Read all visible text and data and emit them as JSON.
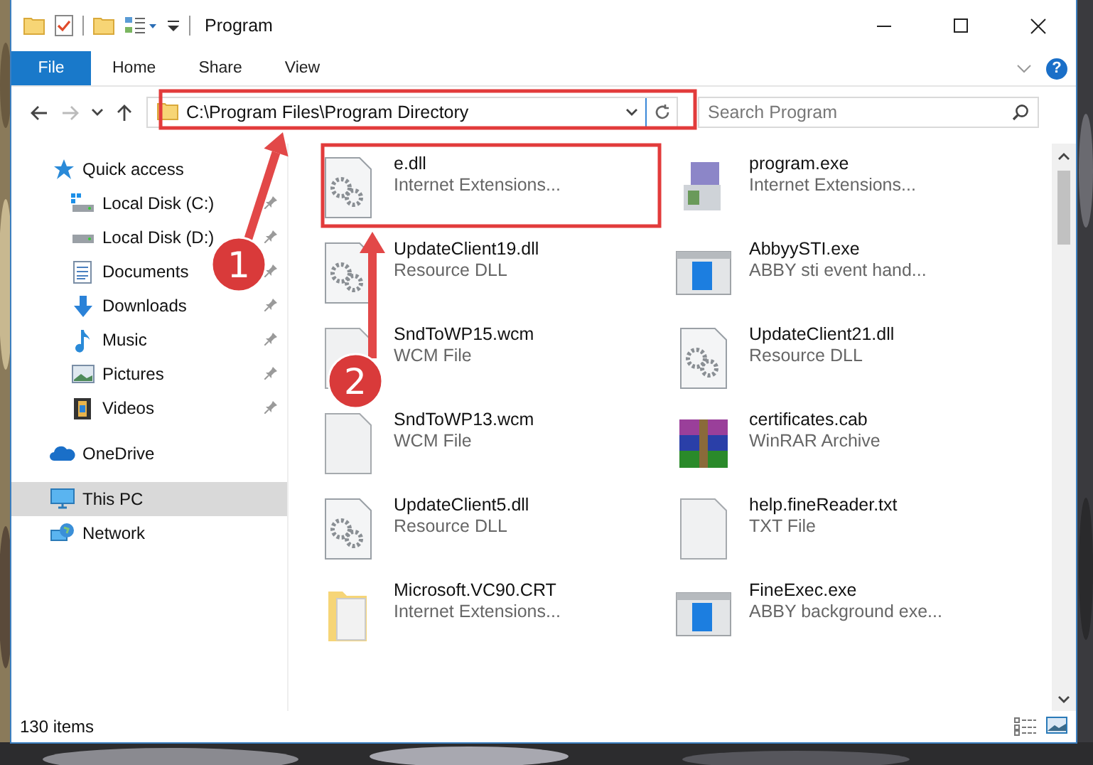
{
  "window": {
    "title": "Program"
  },
  "quick_access_toolbar": [
    {
      "kind": "folder"
    },
    {
      "kind": "properties"
    },
    {
      "kind": "new-folder"
    },
    {
      "kind": "view-dropdown"
    },
    {
      "kind": "customize"
    }
  ],
  "ribbon": {
    "file_tab": "File",
    "tabs": [
      {
        "label": "Home",
        "selected": false
      },
      {
        "label": "Share",
        "selected": false
      },
      {
        "label": "View",
        "selected": false
      }
    ],
    "help": "?"
  },
  "address_bar": {
    "path": "C:\\Program Files\\Program Directory"
  },
  "search": {
    "placeholder": "Search Program"
  },
  "navigation": [
    {
      "label": "Quick access",
      "kind": "star",
      "selected": false,
      "children": [
        {
          "label": "Local Disk (C:)",
          "kind": "drive-c",
          "pinned": true,
          "selected": false
        },
        {
          "label": "Local Disk (D:)",
          "kind": "drive",
          "pinned": true,
          "selected": false
        },
        {
          "label": "Documents",
          "kind": "documents",
          "pinned": true,
          "selected": false
        },
        {
          "label": "Downloads",
          "kind": "downloads",
          "pinned": true,
          "selected": false
        },
        {
          "label": "Music",
          "kind": "music",
          "pinned": true,
          "selected": false
        },
        {
          "label": "Pictures",
          "kind": "pictures",
          "pinned": true,
          "selected": false
        },
        {
          "label": "Videos",
          "kind": "videos",
          "pinned": true,
          "selected": false
        }
      ]
    },
    {
      "label": "OneDrive",
      "kind": "cloud",
      "selected": false
    },
    {
      "label": "This PC",
      "kind": "computer",
      "selected": true
    },
    {
      "label": "Network",
      "kind": "network",
      "selected": false
    }
  ],
  "files": [
    {
      "name": "e.dll",
      "type": "Internet Extensions...",
      "kind": "gear-file"
    },
    {
      "name": "program.exe",
      "type": "Internet Extensions...",
      "kind": "installer"
    },
    {
      "name": "UpdateClient19.dll",
      "type": "Resource DLL",
      "kind": "gear-file"
    },
    {
      "name": "AbbyySTI.exe",
      "type": "ABBY sti event hand...",
      "kind": "app-window"
    },
    {
      "name": "SndToWP15.wcm",
      "type": "WCM File",
      "kind": "blank-file"
    },
    {
      "name": "UpdateClient21.dll",
      "type": "Resource DLL",
      "kind": "gear-file"
    },
    {
      "name": "SndToWP13.wcm",
      "type": "WCM File",
      "kind": "blank-file"
    },
    {
      "name": "certificates.cab",
      "type": "WinRAR Archive",
      "kind": "archive"
    },
    {
      "name": "UpdateClient5.dll",
      "type": "Resource DLL",
      "kind": "gear-file"
    },
    {
      "name": "help.fineReader.txt",
      "type": "TXT File",
      "kind": "blank-file"
    },
    {
      "name": "Microsoft.VC90.CRT",
      "type": "Internet Extensions...",
      "kind": "folder"
    },
    {
      "name": "FineExec.exe",
      "type": "ABBY background exe...",
      "kind": "app-window"
    }
  ],
  "status_bar": {
    "item_count": "130 items"
  },
  "annotations": [
    {
      "label": "1"
    },
    {
      "label": "2"
    }
  ]
}
